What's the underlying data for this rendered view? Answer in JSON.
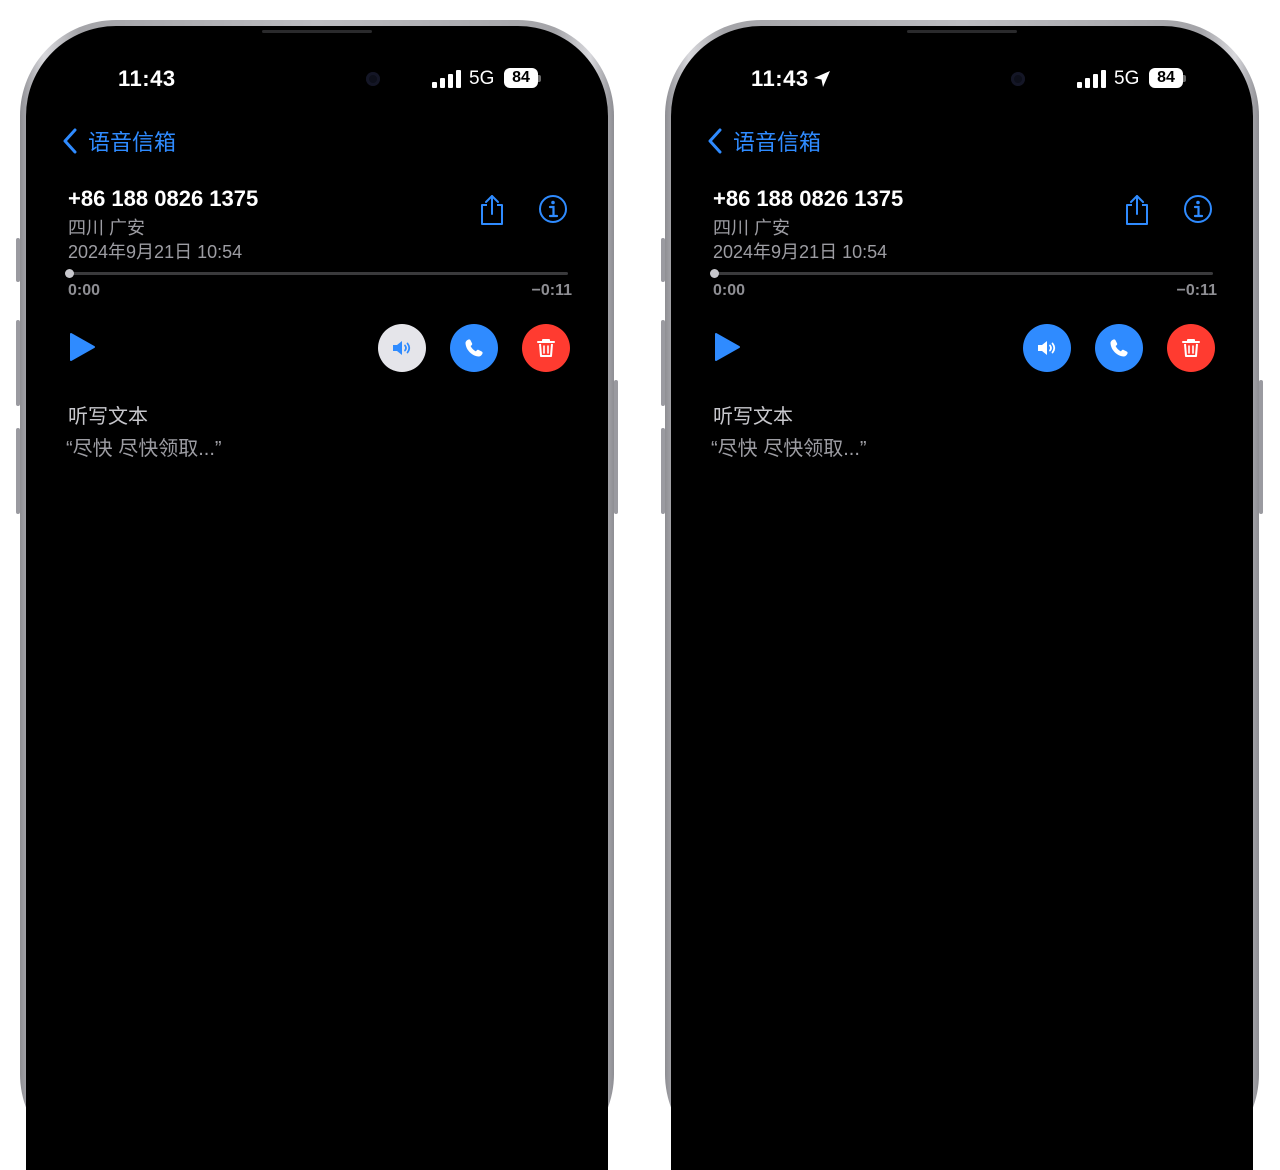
{
  "phones": [
    {
      "status": {
        "time": "11:43",
        "network": "5G",
        "battery": "84",
        "location_arrow": false
      },
      "nav": {
        "back_label": "语音信箱"
      },
      "voicemail": {
        "caller": "+86 188 0826 1375",
        "location": "四川 广安",
        "datetime": "2024年9月21日 10:54",
        "elapsed": "0:00",
        "remaining": "−0:11",
        "progress": 0,
        "speaker_active": false
      },
      "transcript": {
        "title": "听写文本",
        "text": "“尽快 尽快领取...”"
      }
    },
    {
      "status": {
        "time": "11:43",
        "network": "5G",
        "battery": "84",
        "location_arrow": true
      },
      "nav": {
        "back_label": "语音信箱"
      },
      "voicemail": {
        "caller": "+86 188 0826 1375",
        "location": "四川 广安",
        "datetime": "2024年9月21日 10:54",
        "elapsed": "0:00",
        "remaining": "−0:11",
        "progress": 0,
        "speaker_active": true
      },
      "transcript": {
        "title": "听写文本",
        "text": "“尽快 尽快领取...”"
      }
    }
  ],
  "icons": {
    "back": "chevron-left-icon",
    "share": "share-icon",
    "info": "info-icon",
    "play": "play-icon",
    "speaker": "speaker-icon",
    "call": "phone-icon",
    "delete": "trash-icon",
    "location": "location-arrow-icon",
    "signal": "cellular-signal-icon"
  },
  "colors": {
    "accent": "#2f8bff",
    "delete": "#ff3b30",
    "speaker_inactive_bg": "#e5e5ea",
    "speaker_inactive_fg": "#2f8bff",
    "speaker_active_bg": "#2f8bff",
    "speaker_active_fg": "#ffffff",
    "background": "#000000",
    "secondary_text": "#9d9da3"
  }
}
